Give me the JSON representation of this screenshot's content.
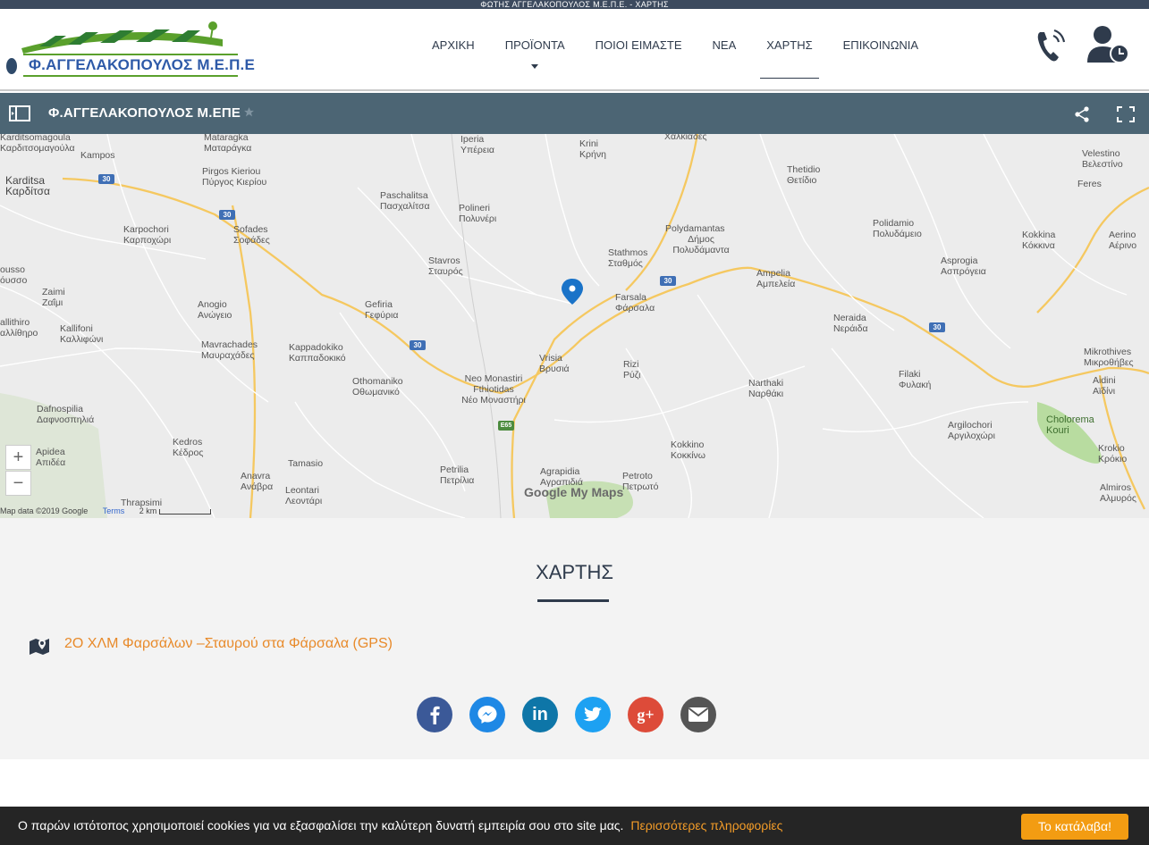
{
  "top_strip": {
    "text": "ΦΩΤΗΣ ΑΓΓΕΛΑΚΟΠΟΥΛΟΣ Μ.Ε.Π.Ε. - ΧΑΡΤΗΣ"
  },
  "logo": {
    "text": "Φ.ΑΓΓΕΛΑΚΟΠΟΥΛΟΣ Μ.Ε.Π.Ε"
  },
  "nav": {
    "items": [
      {
        "label": "ΑΡΧΙΚΗ"
      },
      {
        "label": "ΠΡΟΪΟΝΤΑ"
      },
      {
        "label": "ΠΟΙΟΙ ΕΙΜΑΣΤΕ"
      },
      {
        "label": "ΝΕΑ"
      },
      {
        "label": "ΧΑΡΤΗΣ"
      },
      {
        "label": "ΕΠΙΚΟΙΝΩΝΙΑ"
      }
    ],
    "active": "ΧΑΡΤΗΣ"
  },
  "header_icons": {
    "phone": "phone-ringing-icon",
    "account": "user-clock-icon"
  },
  "map_bar": {
    "title": "Φ.ΑΓΓΕΛΑΚΟΠΟΥΛΟΣ Μ.ΕΠΕ",
    "icons": [
      "sidebar-toggle-icon",
      "star-icon",
      "share-icon",
      "fullscreen-icon"
    ]
  },
  "map": {
    "places": [
      {
        "name": "Mataragka",
        "local": "Ματαράγκα"
      },
      {
        "name": "Karditsomagoula",
        "local": "Καρδιτσομαγούλα"
      },
      {
        "name": "Kampos",
        "local": ""
      },
      {
        "name": "Karditsa",
        "local": "Καρδίτσα"
      },
      {
        "name": "Pirgos Kieriou",
        "local": "Πύργος Κιερίου"
      },
      {
        "name": "Sofades",
        "local": "Σοφάδες"
      },
      {
        "name": "Karpochori",
        "local": "Καρποχώρι"
      },
      {
        "name": "Paschalitsa",
        "local": "Πασχαλίτσα"
      },
      {
        "name": "Polineri",
        "local": "Πολυνέρι"
      },
      {
        "name": "Iperia",
        "local": "Υπέρεια"
      },
      {
        "name": "Krini",
        "local": "Κρήνη"
      },
      {
        "name": "",
        "local": "Χαλκιάδες"
      },
      {
        "name": "Thetidio",
        "local": "Θετίδιο"
      },
      {
        "name": "Velestino",
        "local": "Βελεστίνο"
      },
      {
        "name": "Feres",
        "local": ""
      },
      {
        "name": "Stavros",
        "local": "Σταυρός"
      },
      {
        "name": "Stathmos",
        "local": "Σταθμός"
      },
      {
        "name": "Polydamantas",
        "local": "Δήμος Πολυδάμαντα"
      },
      {
        "name": "Polidamio",
        "local": "Πολυδάμειο"
      },
      {
        "name": "Kokkina",
        "local": "Κόκκινα"
      },
      {
        "name": "Aerino",
        "local": "Αέρινο"
      },
      {
        "name": "Asprogia",
        "local": "Ασπρόγεια"
      },
      {
        "name": "Ampelia",
        "local": "Αμπελεία"
      },
      {
        "name": "Farsala",
        "local": "Φάρσαλα"
      },
      {
        "name": "ousso",
        "local": "όυσσο"
      },
      {
        "name": "Zaimi",
        "local": "Ζαΐμι"
      },
      {
        "name": "Anogio",
        "local": "Ανώγειο"
      },
      {
        "name": "Gefiria",
        "local": "Γεφύρια"
      },
      {
        "name": "allithiro",
        "local": "αλλίθηρο"
      },
      {
        "name": "Kallifoni",
        "local": "Καλλιφώνι"
      },
      {
        "name": "Neraida",
        "local": "Νεράιδα"
      },
      {
        "name": "Mavrachades",
        "local": "Μαυραχάδες"
      },
      {
        "name": "Kappadokiko",
        "local": "Καππαδοκικό"
      },
      {
        "name": "Vrisia",
        "local": "Βρυσιά"
      },
      {
        "name": "Rizi",
        "local": "Ρύζι"
      },
      {
        "name": "Mikrothives",
        "local": "Μικροθήβες"
      },
      {
        "name": "Othomaniko",
        "local": "Οθωμανικό"
      },
      {
        "name": "Neo Monastiri Fthiotidas",
        "local": "Νέο Μοναστήρι"
      },
      {
        "name": "Narthaki",
        "local": "Ναρθάκι"
      },
      {
        "name": "Filaki",
        "local": "Φυλακή"
      },
      {
        "name": "Aidini",
        "local": "Αϊδίνι"
      },
      {
        "name": "Dafnospilia",
        "local": "Δαφνοσπηλιά"
      },
      {
        "name": "Argilochori",
        "local": "Αργιλοχώρι"
      },
      {
        "name": "Cholorema Kouri",
        "local": ""
      },
      {
        "name": "Apidea",
        "local": "Απιδέα"
      },
      {
        "name": "Kedros",
        "local": "Κέδρος"
      },
      {
        "name": "Kokkino",
        "local": "Κοκκίνω"
      },
      {
        "name": "Krokio",
        "local": "Κρόκιο"
      },
      {
        "name": "Tamasio",
        "local": ""
      },
      {
        "name": "Petrilia",
        "local": "Πετρίλια"
      },
      {
        "name": "Agrapidia",
        "local": "Αγραπιδιά"
      },
      {
        "name": "Petroto",
        "local": "Πετρωτό"
      },
      {
        "name": "Anavra",
        "local": "Ανάβρα"
      },
      {
        "name": "Leontari",
        "local": "Λεοντάρι"
      },
      {
        "name": "Almiros",
        "local": "Αλμυρός"
      },
      {
        "name": "Thrapsimi",
        "local": ""
      }
    ],
    "road_labels": [
      "30",
      "E65"
    ],
    "zoom_in": "+",
    "zoom_out": "−",
    "attribution": "Map data ©2019 Google",
    "terms": "Terms",
    "scale": "2 km",
    "brand": "Google My Maps"
  },
  "section": {
    "title": "ΧΑΡΤΗΣ",
    "address": "2Ο ΧΛΜ Φαρσάλων –Σταυρού στα Φάρσαλα (GPS)",
    "social": [
      {
        "name": "facebook",
        "color": "#3b5998"
      },
      {
        "name": "messenger",
        "color": "#1e88e5"
      },
      {
        "name": "linkedin",
        "color": "#0e76a8"
      },
      {
        "name": "twitter",
        "color": "#1da1f2"
      },
      {
        "name": "google-plus",
        "color": "#dd4b39"
      },
      {
        "name": "email",
        "color": "#555555"
      }
    ]
  },
  "cookie": {
    "message": "Ο παρών ιστότοπος χρησιμοποιεί cookies για να εξασφαλίσει την καλύτερη δυνατή εμπειρία σου στο site μας.",
    "more": "Περισσότερες πληροφορίες",
    "accept": "Το κατάλαβα!"
  }
}
